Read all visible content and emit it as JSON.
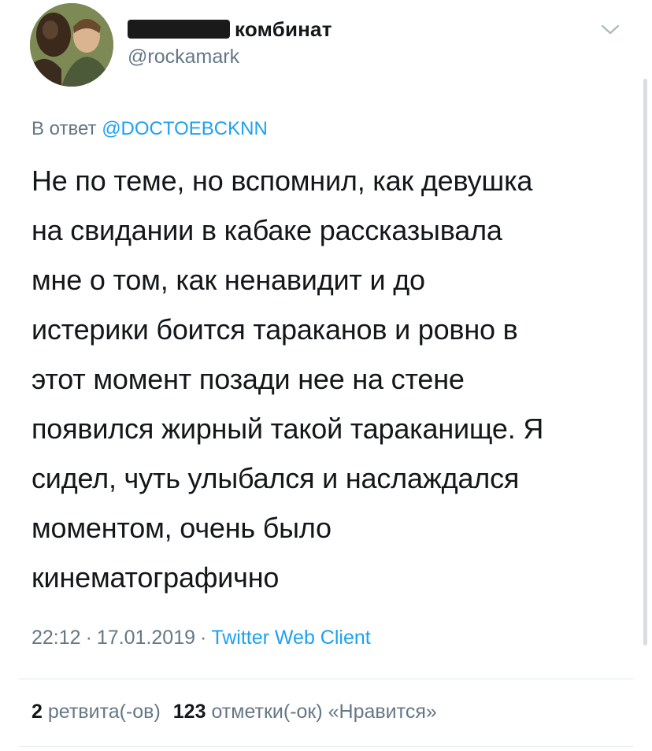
{
  "tweet": {
    "display_name": "комбинат",
    "handle": "@rockamark",
    "reply_prefix": "В ответ ",
    "reply_mention": "@DOCTOEBCKNN",
    "text": "Не по теме, но вспомнил, как девушка\nна свидании в кабаке рассказывала\nмне о том, как ненавидит и до\nистерики боится тараканов и ровно в\nэтот момент позади нее на стене\nпоявился жирный такой тараканище. Я\nсидел, чуть улыбался и наслаждался\nмоментом, очень было\nкинематографично",
    "time": "22:12",
    "date": "17.01.2019",
    "separator": "·",
    "client": "Twitter Web Client",
    "retweets_count": "2",
    "retweets_label": "ретвита(-ов)",
    "likes_count": "123",
    "likes_label": "отметки(-ок) «Нравится»"
  },
  "icons": {
    "menu": "chevron-down-icon"
  },
  "colors": {
    "link": "#1da1f2",
    "muted": "#657786",
    "text": "#14171a"
  }
}
